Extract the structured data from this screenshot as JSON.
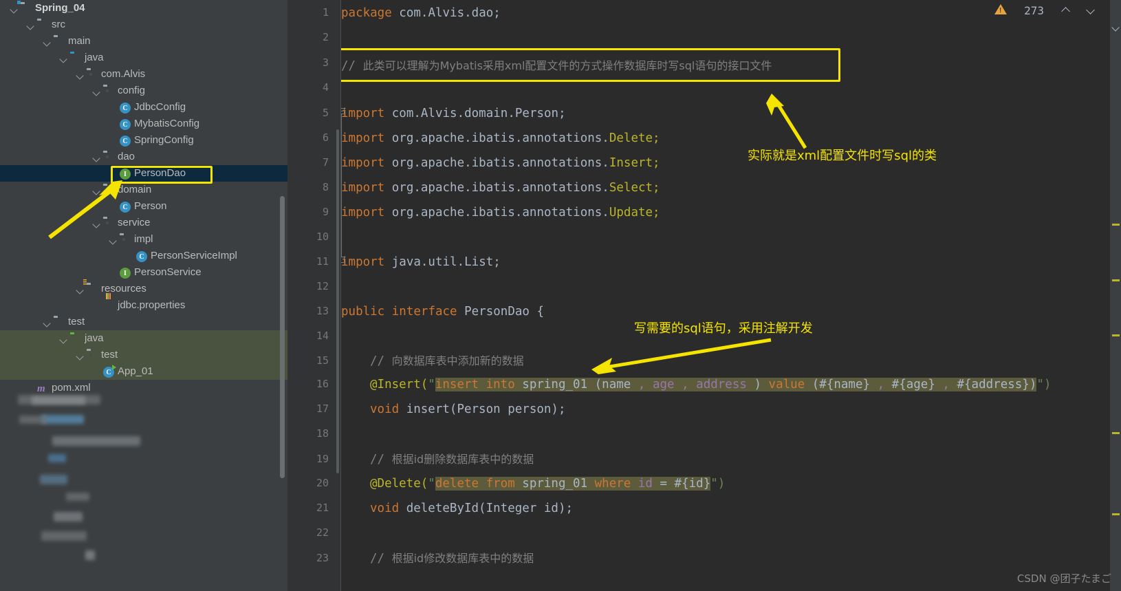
{
  "tree": {
    "items": [
      {
        "label": "Spring_04",
        "indent": 0,
        "icon": "folder-module-icon",
        "bold": true,
        "arrow": true,
        "state": "none"
      },
      {
        "label": "src",
        "indent": 1,
        "icon": "folder-icon",
        "bold": false,
        "arrow": true,
        "state": "none"
      },
      {
        "label": "main",
        "indent": 2,
        "icon": "folder-icon",
        "bold": false,
        "arrow": true,
        "state": "none"
      },
      {
        "label": "java",
        "indent": 3,
        "icon": "folder-source-icon",
        "bold": false,
        "arrow": true,
        "state": "none"
      },
      {
        "label": "com.Alvis",
        "indent": 4,
        "icon": "package-icon",
        "bold": false,
        "arrow": true,
        "state": "none"
      },
      {
        "label": "config",
        "indent": 5,
        "icon": "package-icon",
        "bold": false,
        "arrow": true,
        "state": "none"
      },
      {
        "label": "JdbcConfig",
        "indent": 6,
        "icon": "java-class-icon",
        "bold": false,
        "arrow": false,
        "state": "none"
      },
      {
        "label": "MybatisConfig",
        "indent": 6,
        "icon": "java-class-icon",
        "bold": false,
        "arrow": false,
        "state": "none"
      },
      {
        "label": "SpringConfig",
        "indent": 6,
        "icon": "java-class-icon",
        "bold": false,
        "arrow": false,
        "state": "none"
      },
      {
        "label": "dao",
        "indent": 5,
        "icon": "package-icon",
        "bold": false,
        "arrow": true,
        "state": "none"
      },
      {
        "label": "PersonDao",
        "indent": 6,
        "icon": "java-interface-icon",
        "bold": false,
        "arrow": false,
        "state": "selected"
      },
      {
        "label": "domain",
        "indent": 5,
        "icon": "package-icon",
        "bold": false,
        "arrow": true,
        "state": "none"
      },
      {
        "label": "Person",
        "indent": 6,
        "icon": "java-class-icon",
        "bold": false,
        "arrow": false,
        "state": "none"
      },
      {
        "label": "service",
        "indent": 5,
        "icon": "package-icon",
        "bold": false,
        "arrow": true,
        "state": "none"
      },
      {
        "label": "impl",
        "indent": 6,
        "icon": "package-icon",
        "bold": false,
        "arrow": true,
        "state": "none"
      },
      {
        "label": "PersonServiceImpl",
        "indent": 7,
        "icon": "java-class-icon",
        "bold": false,
        "arrow": false,
        "state": "none"
      },
      {
        "label": "PersonService",
        "indent": 6,
        "icon": "java-interface-icon",
        "bold": false,
        "arrow": false,
        "state": "none"
      },
      {
        "label": "resources",
        "indent": 4,
        "icon": "folder-resources-icon",
        "bold": false,
        "arrow": true,
        "state": "none"
      },
      {
        "label": "jdbc.properties",
        "indent": 5,
        "icon": "properties-file-icon",
        "bold": false,
        "arrow": false,
        "state": "none"
      },
      {
        "label": "test",
        "indent": 2,
        "icon": "folder-icon",
        "bold": false,
        "arrow": true,
        "state": "none"
      },
      {
        "label": "java",
        "indent": 3,
        "icon": "folder-test-source-icon",
        "bold": false,
        "arrow": true,
        "state": "highlighted"
      },
      {
        "label": "test",
        "indent": 4,
        "icon": "package-icon",
        "bold": false,
        "arrow": true,
        "state": "highlighted"
      },
      {
        "label": "App_01",
        "indent": 5,
        "icon": "java-runnable-class-icon",
        "bold": false,
        "arrow": false,
        "state": "highlighted"
      },
      {
        "label": "pom.xml",
        "indent": 1,
        "icon": "maven-icon",
        "bold": false,
        "arrow": false,
        "state": "none"
      }
    ]
  },
  "gutter": {
    "line_numbers": [
      "1",
      "2",
      "3",
      "4",
      "5",
      "6",
      "7",
      "8",
      "9",
      "10",
      "11",
      "12",
      "13",
      "14",
      "15",
      "16",
      "17",
      "18",
      "19",
      "20",
      "21",
      "22",
      "23"
    ]
  },
  "editor": {
    "lines": {
      "l1_kw": "package",
      "l1_pkg": " com.Alvis.dao;",
      "l3_slashes": "// ",
      "l3_comment": "此类可以理解为Mybatis采用xml配置文件的方式操作数据库时写sql语句的接口文件",
      "l5_kw": "import",
      "l5_path": " com.Alvis.domain.",
      "l5_cls": "Person;",
      "l6_kw": "import",
      "l6_path": " org.apache.ibatis.annotations.",
      "l6_cls": "Delete;",
      "l7_kw": "import",
      "l7_path": " org.apache.ibatis.annotations.",
      "l7_cls": "Insert;",
      "l8_kw": "import",
      "l8_path": " org.apache.ibatis.annotations.",
      "l8_cls": "Select;",
      "l9_kw": "import",
      "l9_path": " org.apache.ibatis.annotations.",
      "l9_cls": "Update;",
      "l11_kw": "import",
      "l11_path": " java.util.",
      "l11_cls": "List;",
      "l13_kw1": "public ",
      "l13_kw2": "interface ",
      "l13_name": "PersonDao ",
      "l13_brace": "{",
      "l15_slashes": "// ",
      "l15_comment": "向数据库表中添加新的数据",
      "l16_ann": "@Insert(",
      "l16_quote": "\"",
      "l16_sql_a": "insert into ",
      "l16_sql_b": "spring_01 ",
      "l16_sql_c": "(name",
      "l16_sql_comma1": " , ",
      "l16_sql_d": "age",
      "l16_sql_comma2": " , ",
      "l16_sql_e": "address",
      "l16_sql_f": " ) ",
      "l16_sql_g": "value",
      "l16_sql_h": " (#{name}",
      "l16_sql_comma3": " , ",
      "l16_sql_i": "#{age}",
      "l16_sql_comma4": " , ",
      "l16_sql_j": "#{address})",
      "l16_tail": "\")",
      "l17_kw": "void ",
      "l17_name": "insert(",
      "l17_param_t": "Person",
      "l17_param_n": " person);",
      "l19_slashes": "// ",
      "l19_comment": "根据id删除数据库表中的数据",
      "l20_ann": "@Delete(",
      "l20_quote": "\"",
      "l20_sql_a": "delete from ",
      "l20_sql_b": "spring_01 ",
      "l20_sql_c": "where ",
      "l20_sql_d": "id",
      "l20_sql_e": " = ",
      "l20_sql_f": "#{id}",
      "l20_tail": "\")",
      "l21_kw": "void ",
      "l21_name": "deleteById(",
      "l21_param_t": "Integer",
      "l21_param_n": " id);",
      "l23_slashes": "// ",
      "l23_comment": "根据id修改数据库表中的数据"
    }
  },
  "annotations": {
    "note_top": "实际就是xml配置文件时写sql的类",
    "note_mid": "写需要的sql语句，采用注解开发"
  },
  "status": {
    "warning_count": "273"
  },
  "watermark": "CSDN @团子たまご",
  "colors": {
    "accent_yellow": "#f5e400",
    "editor_bg": "#2b2b2b",
    "tree_bg": "#3c3f41",
    "selection_blue": "#0d293e",
    "selection_green": "#4a5340",
    "keyword": "#cc7832",
    "annotation": "#bbb529",
    "string": "#6a8759",
    "comment": "#808080",
    "identifier": "#a9b7c6",
    "field": "#9876aa"
  }
}
